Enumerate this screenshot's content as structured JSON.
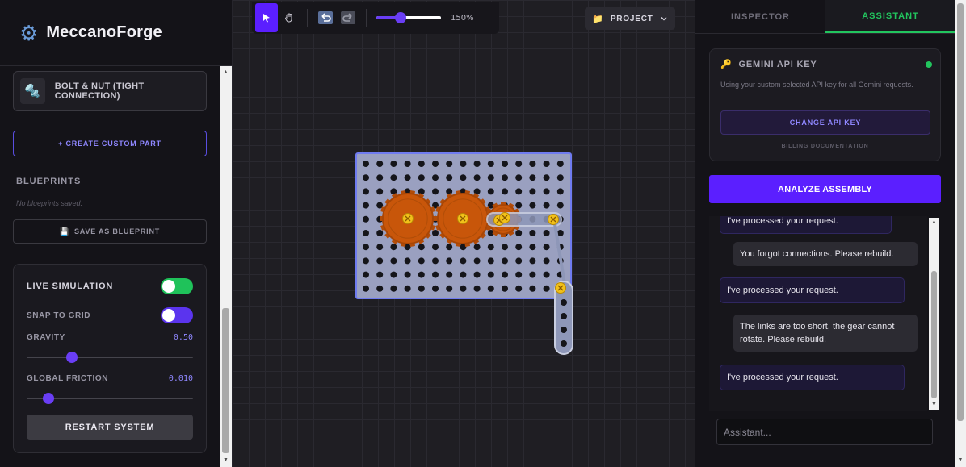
{
  "brand": {
    "title": "MeccanoForge",
    "icon": "gear-icon"
  },
  "parts": {
    "bolt_nut_label": "BOLT & NUT (TIGHT CONNECTION)"
  },
  "sidebar": {
    "create_custom_label": "+ CREATE CUSTOM PART",
    "blueprints_title": "BLUEPRINTS",
    "no_blueprints": "No blueprints saved.",
    "save_blueprint_label": "SAVE AS BLUEPRINT",
    "save_icon": "💾"
  },
  "simulation": {
    "live_label": "LIVE SIMULATION",
    "live_on": true,
    "snap_label": "SNAP TO GRID",
    "snap_on": true,
    "gravity_label": "GRAVITY",
    "gravity_value": "0.50",
    "gravity_fraction": 0.27,
    "friction_label": "GLOBAL FRICTION",
    "friction_value": "0.010",
    "friction_fraction": 0.13,
    "restart_label": "RESTART SYSTEM"
  },
  "toolbar": {
    "zoom_label": "150%",
    "zoom_fraction": 0.38,
    "project_label": "PROJECT",
    "project_icon": "📁"
  },
  "right_panel": {
    "tab_inspector": "INSPECTOR",
    "tab_assistant": "ASSISTANT",
    "api_title": "GEMINI API KEY",
    "api_desc": "Using your custom selected API key for all Gemini requests.",
    "change_key_label": "CHANGE API KEY",
    "billing_label": "BILLING DOCUMENTATION",
    "analyze_label": "ANALYZE ASSEMBLY",
    "chat_placeholder": "Assistant...",
    "messages": [
      {
        "role": "bot",
        "text": "I've processed your request."
      },
      {
        "role": "user",
        "text": "You forgot connections. Please rebuild."
      },
      {
        "role": "bot",
        "text": "I've processed your request."
      },
      {
        "role": "user",
        "text": "The links are too short, the gear cannot rotate. Please rebuild."
      },
      {
        "role": "bot",
        "text": "I've processed your request."
      }
    ]
  },
  "colors": {
    "accent": "#5b1fff",
    "success": "#22c55e",
    "gear": "#c8560a",
    "plate": "#9aa0c0"
  }
}
